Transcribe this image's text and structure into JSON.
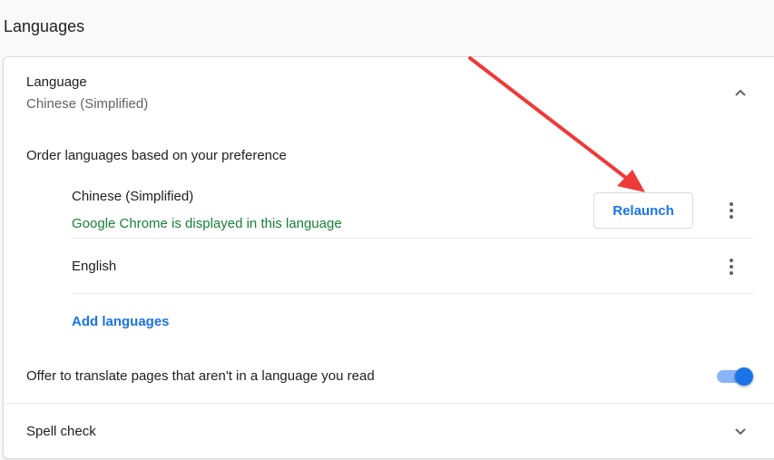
{
  "page": {
    "heading": "Languages"
  },
  "language_section": {
    "title": "Language",
    "current": "Chinese (Simplified)",
    "collapse_icon": "chevron-up-icon"
  },
  "order_label": "Order languages based on your preference",
  "languages": [
    {
      "name": "Chinese (Simplified)",
      "note": "Google Chrome is displayed in this language",
      "action_label": "Relaunch",
      "menu_icon": "more-vert-icon"
    },
    {
      "name": "English",
      "menu_icon": "more-vert-icon"
    }
  ],
  "add_languages_label": "Add languages",
  "translate": {
    "label": "Offer to translate pages that aren't in a language you read",
    "enabled": true
  },
  "spell_check": {
    "label": "Spell check",
    "expand_icon": "chevron-down-icon"
  },
  "colors": {
    "accent": "#1a73e8",
    "success_text": "#188038",
    "annotation_arrow": "#ef3a3a"
  }
}
